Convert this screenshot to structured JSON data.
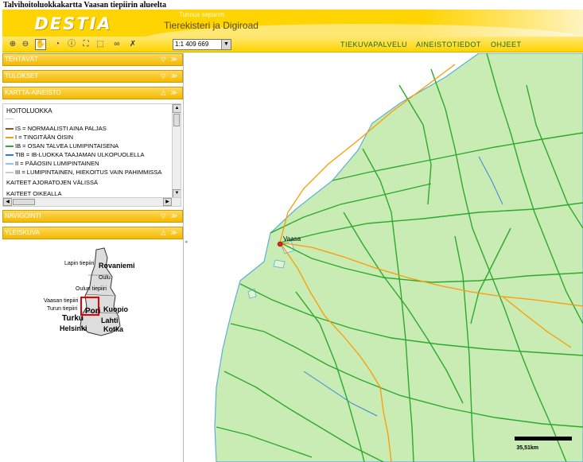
{
  "page": {
    "caption": "Talvihoitoluokkakartta Vaasan tiepiirin alueelta"
  },
  "header": {
    "logo": "DESTIA",
    "subtitle": "Tunnus sepanm",
    "title": "Tierekisteri ja Digiroad"
  },
  "toolbar": {
    "tools": [
      {
        "name": "zoom-in-icon",
        "glyph": "⊕"
      },
      {
        "name": "zoom-out-icon",
        "glyph": "⊖"
      },
      {
        "name": "pan-hand-icon",
        "glyph": "✋"
      },
      {
        "name": "zoom-extent-icon",
        "glyph": "◔"
      },
      {
        "name": "info-icon",
        "glyph": "ⓘ"
      },
      {
        "name": "identify-icon",
        "glyph": "⛶"
      },
      {
        "name": "select-area-icon",
        "glyph": "⬚"
      },
      {
        "name": "binoculars-icon",
        "glyph": "∞"
      },
      {
        "name": "clear-icon",
        "glyph": "✗"
      }
    ],
    "scale": "1:1 409 669",
    "links": {
      "tiekuvapalvelu": "TIEKUVAPALVELU",
      "aineistotiedot": "AINEISTOTIEDOT",
      "ohjeet": "OHJEET"
    }
  },
  "sidebar": {
    "panels": {
      "tehtavat": {
        "label": "TEHTÄVÄT",
        "controls": "▽ ≫"
      },
      "tulokset": {
        "label": "TULOKSET",
        "controls": "▽ ≫"
      },
      "kartta": {
        "label": "KARTTA-AINEISTO",
        "controls": "△ ≫"
      },
      "navigointi": {
        "label": "NAVIGOINTI",
        "controls": "▽ ≫"
      },
      "yleiskuva": {
        "label": "YLEISKUVA",
        "controls": "△ ≫"
      }
    },
    "legend": {
      "title": "HOITOLUOKKA",
      "rows": [
        {
          "text": "IS = NORMAALISTI AINA PALJAS",
          "color": "#8b5a2b"
        },
        {
          "text": "I = TINGITÄÄN ÖISIN",
          "color": "#ff9900"
        },
        {
          "text": "IB = OSAN TALVEA LUMIPINTAISENA",
          "color": "#33aa33"
        },
        {
          "text": "TIB = IB-LUOKKA TAAJAMAN ULKOPUOLELLA",
          "color": "#2a7dd4"
        },
        {
          "text": "II = PÄÄOSIN LUMIPINTAINEN",
          "color": "#88c4ff"
        },
        {
          "text": "III = LUMIPINTAINEN, HIEKOITUS VAIN PAHIMMISSA",
          "color": "#cccccc"
        }
      ],
      "extra": [
        "KAITEET AJORATOJEN VÄLISSÄ",
        "KAITEET OIKEALLA"
      ]
    },
    "overview": {
      "labels": {
        "lappi": "Lapin tiepiiri",
        "rovaniemi": "Rovaniemi",
        "oulu": "Oulu",
        "oulun": "Oulun tiepiiri",
        "vaasan": "Vaasan tiepiiri",
        "turun": "Turun tiepiiri",
        "kuopio": "Kuopio",
        "turku": "Turku",
        "pori": "Pori",
        "lahti": "Lahti",
        "helsinki": "Helsinki",
        "kotka": "Kotka"
      }
    }
  },
  "map": {
    "place": "Vaasa",
    "scale_label": "35,51km",
    "colors": {
      "land": "#c8ecb4",
      "sea": "#ffffff",
      "road_green": "#2ea82e",
      "road_orange": "#ff9a00",
      "road_blue": "#3a86d8"
    }
  }
}
